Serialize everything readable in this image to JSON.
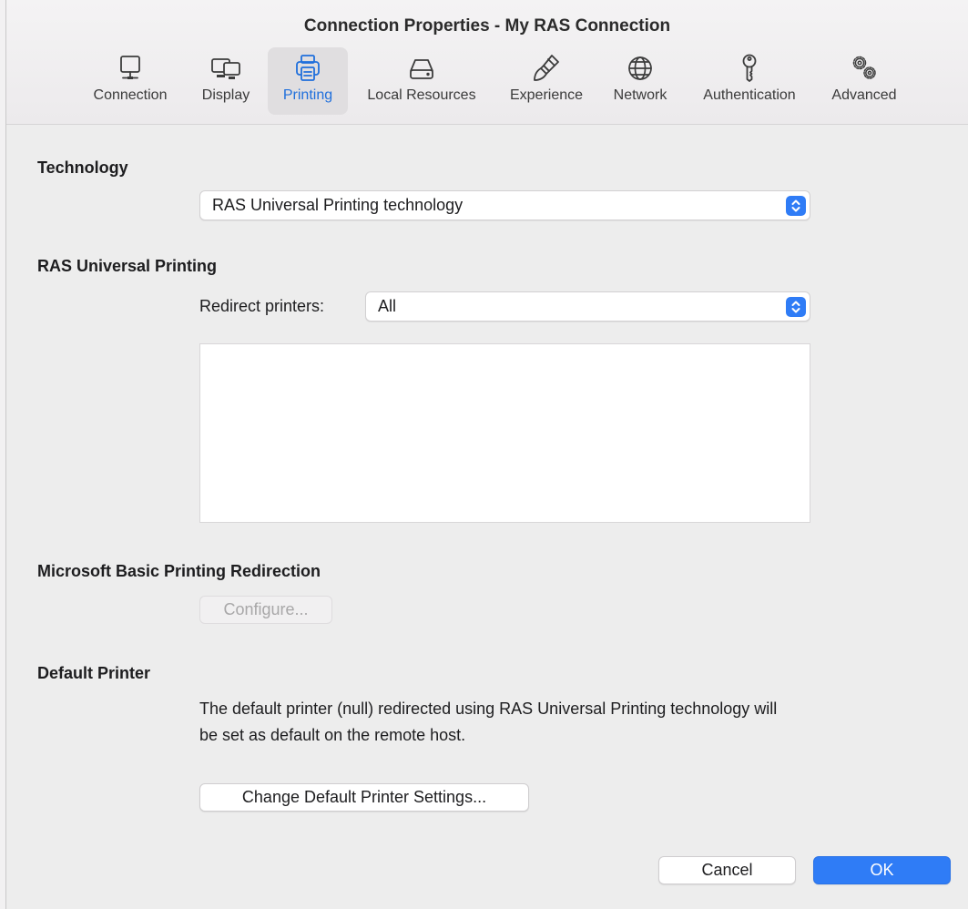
{
  "window": {
    "title": "Connection Properties - My RAS Connection"
  },
  "tabs": [
    {
      "label": "Connection",
      "icon": "monitor-icon"
    },
    {
      "label": "Display",
      "icon": "displays-icon"
    },
    {
      "label": "Printing",
      "icon": "printer-icon"
    },
    {
      "label": "Local Resources",
      "icon": "drive-icon"
    },
    {
      "label": "Experience",
      "icon": "brush-icon"
    },
    {
      "label": "Network",
      "icon": "globe-icon"
    },
    {
      "label": "Authentication",
      "icon": "key-icon"
    },
    {
      "label": "Advanced",
      "icon": "gears-icon"
    }
  ],
  "active_tab": "Printing",
  "technology": {
    "heading": "Technology",
    "selected": "RAS Universal Printing technology"
  },
  "universal_printing": {
    "heading": "RAS Universal Printing",
    "redirect_label": "Redirect printers:",
    "redirect_selected": "All"
  },
  "basic_printing": {
    "heading": "Microsoft Basic Printing Redirection",
    "configure_label": "Configure..."
  },
  "default_printer": {
    "heading": "Default Printer",
    "description_line1": "The default printer (null) redirected using RAS Universal Printing technology will",
    "description_line2": "be set as default on the remote host.",
    "change_label": "Change Default Printer Settings..."
  },
  "footer": {
    "cancel_label": "Cancel",
    "ok_label": "OK"
  },
  "colors": {
    "accent": "#2f7cf6",
    "active_tab_text": "#1f6fdc",
    "background": "#ededed"
  }
}
